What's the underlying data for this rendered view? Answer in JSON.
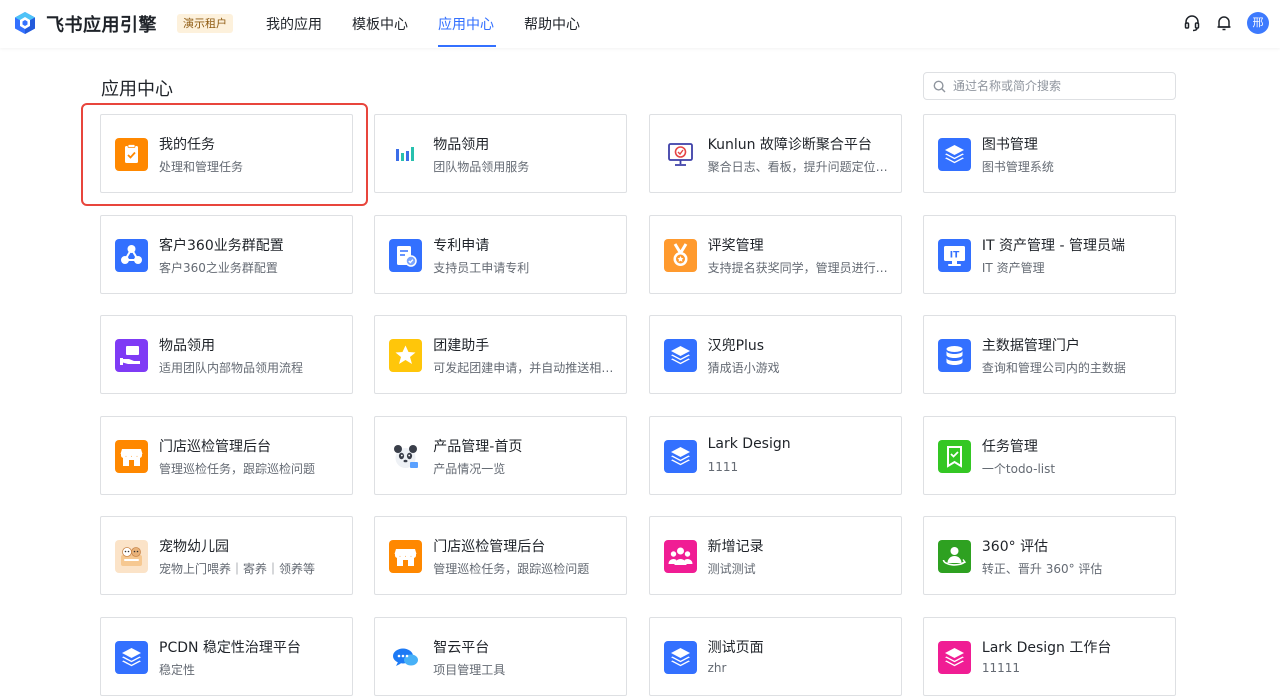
{
  "header": {
    "brand": "飞书应用引擎",
    "tenant_badge": "演示租户",
    "nav": [
      "我的应用",
      "模板中心",
      "应用中心",
      "帮助中心"
    ],
    "active_nav": "应用中心",
    "avatar_text": "邢",
    "icons": [
      "headset-icon",
      "bell-icon"
    ]
  },
  "main": {
    "title": "应用中心",
    "search_placeholder": "通过名称或简介搜索"
  },
  "apps": [
    {
      "name": "我的任务",
      "desc": "处理和管理任务",
      "icon": "clipboard-check-icon",
      "color": "#ff8800"
    },
    {
      "name": "物品领用",
      "desc": "团队物品领用服务",
      "icon": "bar-chart-icon",
      "color": "#ffffff"
    },
    {
      "name": "Kunlun 故障诊断聚合平台",
      "desc": "聚合日志、看板，提升问题定位效率",
      "icon": "monitor-icon",
      "color": "#ffffff"
    },
    {
      "name": "图书管理",
      "desc": "图书管理系统",
      "icon": "layers-icon",
      "color": "#3370ff"
    },
    {
      "name": "客户360业务群配置",
      "desc": "客户360之业务群配置",
      "icon": "group-circle-icon",
      "color": "#3370ff"
    },
    {
      "name": "专利申请",
      "desc": "支持员工申请专利",
      "icon": "document-check-icon",
      "color": "#3370ff"
    },
    {
      "name": "评奖管理",
      "desc": "支持提名获奖同学，管理员进行评审",
      "icon": "medal-icon",
      "color": "#ff9a2e"
    },
    {
      "name": "IT 资产管理 - 管理员端",
      "desc": "IT 资产管理",
      "icon": "it-monitor-icon",
      "color": "#3370ff"
    },
    {
      "name": "物品领用",
      "desc": "适用团队内部物品领用流程",
      "icon": "hand-box-icon",
      "color": "#7f3bf5"
    },
    {
      "name": "团建助手",
      "desc": "可发起团建申请，并自动推送相关信息",
      "icon": "star-icon",
      "color": "#ffc60a"
    },
    {
      "name": "汉兜Plus",
      "desc": "猜成语小游戏",
      "icon": "layers-icon",
      "color": "#3370ff"
    },
    {
      "name": "主数据管理门户",
      "desc": "查询和管理公司内的主数据",
      "icon": "database-icon",
      "color": "#3370ff"
    },
    {
      "name": "门店巡检管理后台",
      "desc": "管理巡检任务，跟踪巡检问题",
      "icon": "store-icon",
      "color": "#ff8800"
    },
    {
      "name": "产品管理-首页",
      "desc": "产品情况一览",
      "icon": "panda-icon",
      "color": "#ffffff"
    },
    {
      "name": "Lark Design",
      "desc": "1111",
      "icon": "layers-icon",
      "color": "#3370ff"
    },
    {
      "name": "任务管理",
      "desc": "一个todo-list",
      "icon": "bookmark-check-icon",
      "color": "#34c724"
    },
    {
      "name": "宠物幼儿园",
      "desc": "宠物上门喂养｜寄养｜领养等",
      "icon": "pet-icon",
      "color": "#fbe3c8"
    },
    {
      "name": "门店巡检管理后台",
      "desc": "管理巡检任务，跟踪巡检问题",
      "icon": "store-icon",
      "color": "#ff8800"
    },
    {
      "name": "新增记录",
      "desc": "测试测试",
      "icon": "people-icon",
      "color": "#f01d94"
    },
    {
      "name": "360° 评估",
      "desc": "转正、晋升 360° 评估",
      "icon": "person-cycle-icon",
      "color": "#2ea121"
    },
    {
      "name": "PCDN 稳定性治理平台",
      "desc": "稳定性",
      "icon": "layers-icon",
      "color": "#3370ff"
    },
    {
      "name": "智云平台",
      "desc": "项目管理工具",
      "icon": "chat-cloud-icon",
      "color": "#ffffff"
    },
    {
      "name": "测试页面",
      "desc": "zhr",
      "icon": "layers-icon",
      "color": "#3370ff"
    },
    {
      "name": "Lark Design 工作台",
      "desc": "11111",
      "icon": "layers-icon",
      "color": "#f01d94"
    }
  ]
}
